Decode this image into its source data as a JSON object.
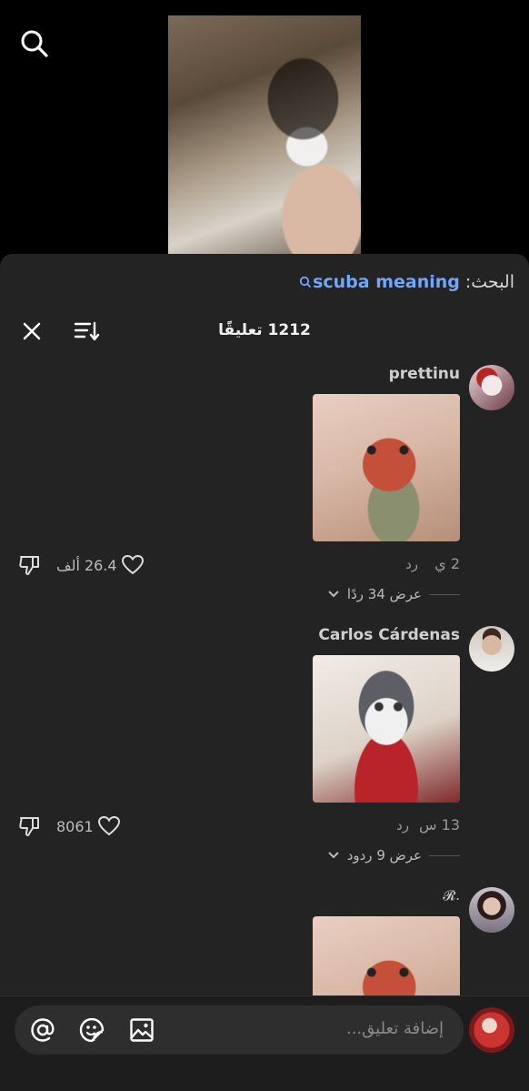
{
  "search": {
    "prefix": "البحث:",
    "query": "scuba meaning"
  },
  "header": {
    "comment_count": "1212 تعليقًا"
  },
  "comments": [
    {
      "username": "prettinu",
      "time": "2 ي",
      "reply": "رد",
      "likes": "26.4 ألف",
      "view_replies": "عرض 34 ردًا"
    },
    {
      "username": "Carlos Cárdenas",
      "time": "13 س",
      "reply": "رد",
      "likes": "8061",
      "view_replies": "عرض 9 ردود"
    },
    {
      "username": "𝓡."
    }
  ],
  "composer": {
    "placeholder": "إضافة تعليق..."
  },
  "icons": [
    "search-icon",
    "close-icon",
    "sort-icon",
    "dislike-icon",
    "heart-icon",
    "chevron-down-icon",
    "mention-icon",
    "sticker-icon",
    "image-icon"
  ],
  "colors": {
    "accent": "#6fa6ff",
    "panel": "#232323"
  }
}
